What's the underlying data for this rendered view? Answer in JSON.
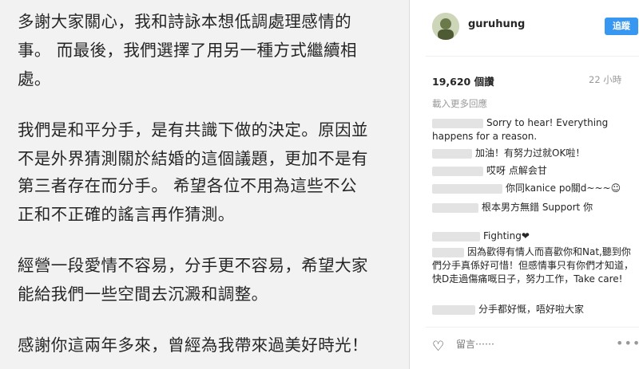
{
  "post": {
    "lines": [
      "多謝大家關心，我和詩詠本想低調處理感情的",
      "事。 而最後，我們選擇了用另一種方式繼續相",
      "處。",
      "我們是和平分手，是有共識下做的決定。原因並",
      "不是外界猜測關於結婚的這個議題，更加不是有",
      "第三者存在而分手。 希望各位不用為這些不公",
      "正和不正確的謠言再作猜測。",
      "經營一段愛情不容易，分手更不容易，希望大家",
      "能給我們一些空間去沉澱和調整。",
      "感謝你這兩年多來，曾經為我帶來過美好時光！"
    ]
  },
  "header": {
    "username": "guruhung",
    "follow_label": "追蹤"
  },
  "stats": {
    "likes": "19,620 個讚",
    "time": "22 小時"
  },
  "load_more": "載入更多回應",
  "comments": [
    {
      "text": "Sorry to hear! Everything happens for a reason."
    },
    {
      "text": "加油！有努力过就OK啦！"
    },
    {
      "text": "哎呀 点解会甘"
    },
    {
      "text": "你同kanice po關d~~~☺"
    },
    {
      "text": "根本男方無錯 Support 你"
    },
    {
      "text": "Fighting❤"
    },
    {
      "text": "因為歡得有情人而喜歡你和Nat,聽到你們分手真係好可惜！但感情事只有你們才知道，快D走過傷痛嘅日子，努力工作，Take care!"
    },
    {
      "text": "分手都好慨，唔好啦大家"
    }
  ],
  "footer": {
    "comment_placeholder": "留言⋯⋯",
    "more_label": "•••"
  },
  "icons": {
    "heart": "heart-icon",
    "more": "more-options-icon"
  }
}
